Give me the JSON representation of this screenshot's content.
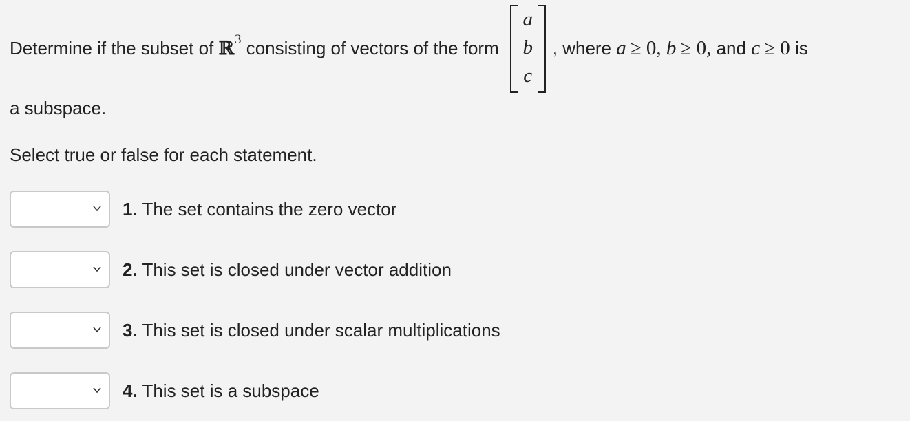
{
  "question": {
    "intro": "Determine if the subset of",
    "space_symbol": "ℝ",
    "space_exponent": "3",
    "middle": "consisting of vectors of the form",
    "vector_entries": [
      "a",
      "b",
      "c"
    ],
    "comma": ",",
    "where_text": "where",
    "conditions": [
      {
        "var": "a",
        "rel": "≥ 0,"
      },
      {
        "var": "b",
        "rel": "≥ 0,"
      },
      {
        "and": "and",
        "var": "c",
        "rel": "≥ 0"
      }
    ],
    "tail": "is",
    "line2": "a subspace."
  },
  "instructions": "Select true or false for each statement.",
  "statements": [
    {
      "number": "1.",
      "text": "The set contains the zero vector",
      "selected": ""
    },
    {
      "number": "2.",
      "text": "This set is closed under vector addition",
      "selected": ""
    },
    {
      "number": "3.",
      "text": "This set is closed under scalar multiplications",
      "selected": ""
    },
    {
      "number": "4.",
      "text": "This set is a subspace",
      "selected": ""
    }
  ],
  "icons": {
    "dropdown": "chevron-down-icon"
  },
  "colors": {
    "background": "#f3f3f3",
    "text": "#222222",
    "select_border": "#c9c9c9"
  }
}
